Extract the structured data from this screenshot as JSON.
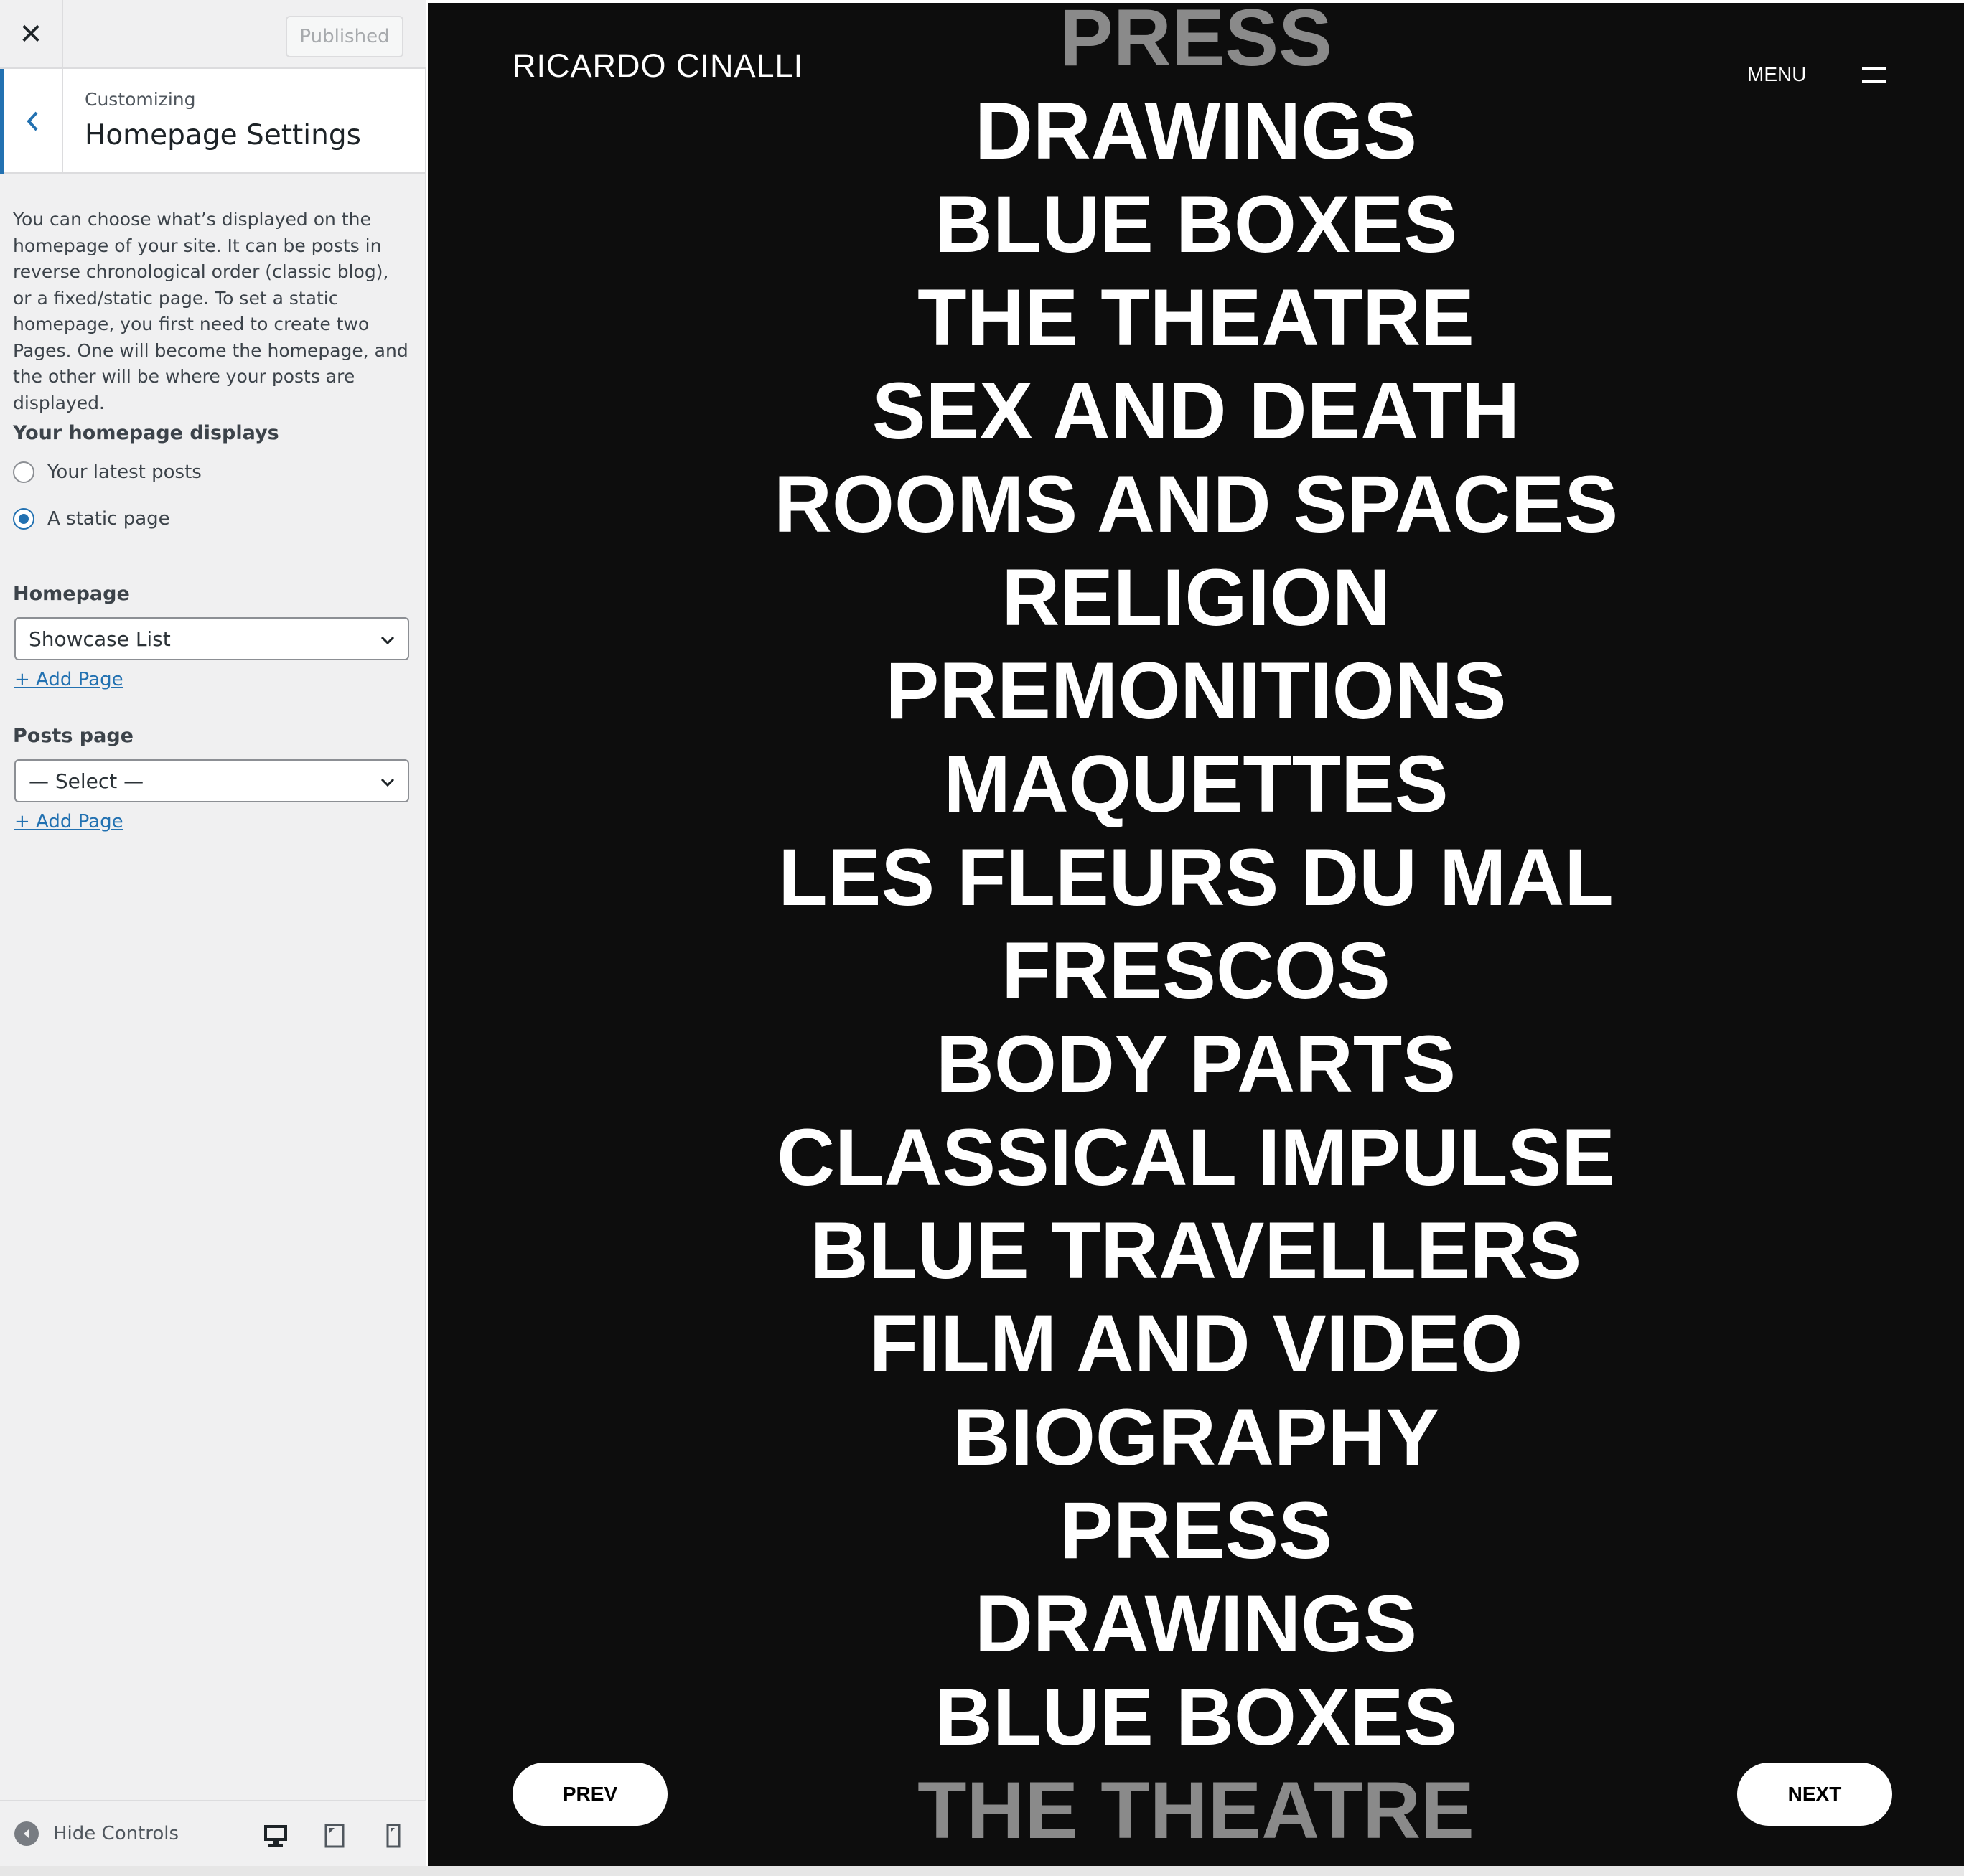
{
  "topbar": {
    "close_glyph": "✕",
    "publish_label": "Published"
  },
  "section": {
    "eyebrow": "Customizing",
    "title": "Homepage Settings"
  },
  "description": "You can choose what’s displayed on the homepage of your site. It can be posts in reverse chronological order (classic blog), or a fixed/static page. To set a static homepage, you first need to create two Pages. One will become the homepage, and the other will be where your posts are displayed.",
  "homepage_displays": {
    "heading": "Your homepage displays",
    "options": [
      {
        "label": "Your latest posts",
        "checked": false
      },
      {
        "label": "A static page",
        "checked": true
      }
    ]
  },
  "homepage": {
    "heading": "Homepage",
    "selected": "Showcase List",
    "add_link": "+ Add Page"
  },
  "posts_page": {
    "heading": "Posts page",
    "selected": "— Select —",
    "add_link": "+ Add Page"
  },
  "footer": {
    "hide_label": "Hide Controls",
    "devices": [
      "desktop-icon",
      "tablet-icon",
      "mobile-icon"
    ],
    "active_device": "desktop"
  },
  "preview": {
    "site_title": "RICARDO CINALLI",
    "menu_label": "MENU",
    "items": [
      "PRESS",
      "DRAWINGS",
      "BLUE BOXES",
      "THE THEATRE",
      "SEX AND DEATH",
      "ROOMS AND SPACES",
      "RELIGION",
      "PREMONITIONS",
      "MAQUETTES",
      "LES FLEURS DU MAL",
      "FRESCOS",
      "BODY PARTS",
      "CLASSICAL IMPULSE",
      "BLUE TRAVELLERS",
      "FILM AND VIDEO",
      "BIOGRAPHY",
      "PRESS",
      "DRAWINGS",
      "BLUE BOXES",
      "THE THEATRE"
    ],
    "prev_label": "PREV",
    "next_label": "NEXT",
    "colors": {
      "background": "#0d0d0d",
      "text": "#ffffff",
      "accent": "#2271b1"
    }
  }
}
